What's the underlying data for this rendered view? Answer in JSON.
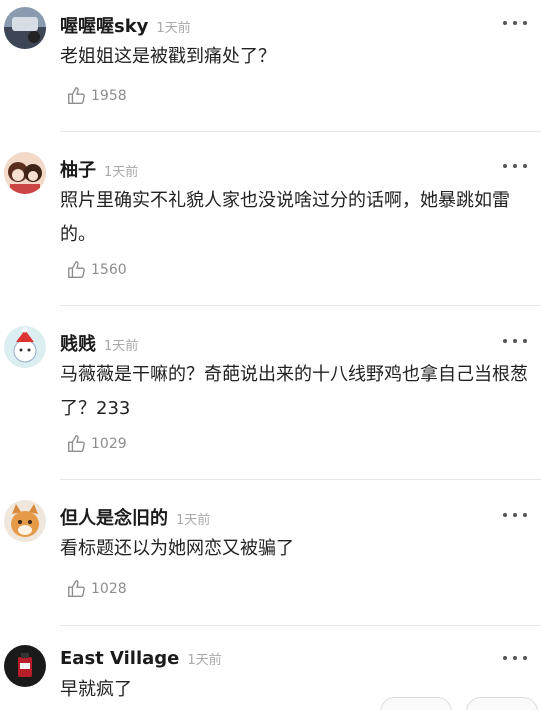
{
  "comments": [
    {
      "name": "喔喔喔sky",
      "time": "1天前",
      "text": "老姐姐这是被戳到痛处了？",
      "likes": "1958"
    },
    {
      "name": "柚子",
      "time": "1天前",
      "text": "照片里确实不礼貌人家也没说啥过分的话啊，她暴跳如雷的。",
      "likes": "1560"
    },
    {
      "name": "贱贱",
      "time": "1天前",
      "text": "马薇薇是干嘛的？奇葩说出来的十八线野鸡也拿自己当根葱了？233",
      "likes": "1029"
    },
    {
      "name": "但人是念旧的",
      "time": "1天前",
      "text": "看标题还以为她网恋又被骗了",
      "likes": "1028"
    },
    {
      "name": "East Village",
      "time": "1天前",
      "text": "早就疯了",
      "likes": ""
    }
  ],
  "colors": {
    "name": "#1b1b1b",
    "time": "#a9a9a9",
    "like": "#8d8d8d",
    "divider": "#e6e6e6"
  }
}
